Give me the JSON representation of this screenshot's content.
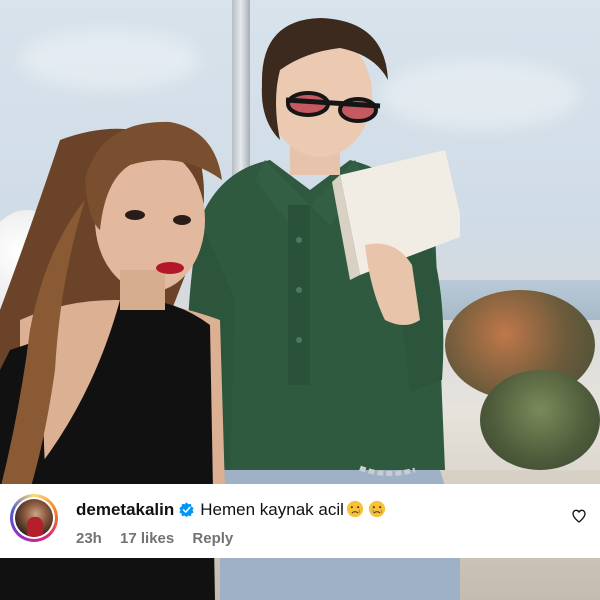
{
  "comment": {
    "username": "demetakalin",
    "verified_icon": "verified-badge-icon",
    "text": "Hemen kaynak acil",
    "emojis": [
      "crying-face-emoji",
      "crying-face-emoji"
    ],
    "meta": {
      "time": "23h",
      "likes": "17 likes",
      "reply": "Reply"
    },
    "like_icon": "heart-outline-icon"
  },
  "colors": {
    "verified_blue": "#0095f6",
    "meta_gray": "#737373",
    "shirt_green": "#2f5a3f",
    "dress_black": "#111111"
  }
}
